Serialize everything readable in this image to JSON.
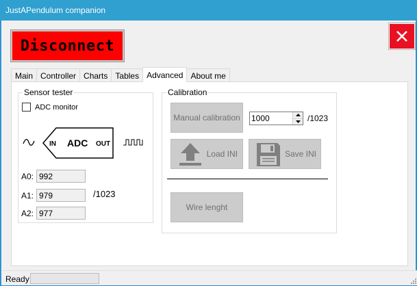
{
  "window": {
    "title": "JustAPendulum companion"
  },
  "header": {
    "disconnect_label": "Disconnect",
    "close_icon": "close-icon"
  },
  "tabs": [
    {
      "label": "Main"
    },
    {
      "label": "Controller"
    },
    {
      "label": "Charts"
    },
    {
      "label": "Tables"
    },
    {
      "label": "Advanced"
    },
    {
      "label": "About me"
    }
  ],
  "sensor_tester": {
    "title": "Sensor tester",
    "adc_monitor_label": "ADC monitor",
    "adc_monitor_checked": false,
    "diagram": {
      "in_label": "IN",
      "adc_label": "ADC",
      "out_label": "OUT"
    },
    "readings": [
      {
        "label": "A0:",
        "value": "992"
      },
      {
        "label": "A1:",
        "value": "979"
      },
      {
        "label": "A2:",
        "value": "977"
      }
    ],
    "max_label": "/1023"
  },
  "calibration": {
    "title": "Calibration",
    "manual_label": "Manual calibration",
    "spin_value": "1000",
    "spin_max_label": "/1023",
    "load_label": "Load INI",
    "save_label": "Save INI",
    "wire_label": "Wire lenght"
  },
  "status": {
    "text": "Ready"
  },
  "colors": {
    "disconnect_bg": "#ff0000",
    "close_bg": "#e81123",
    "titlebar": "#2fa0cf",
    "button_gray": "#cccccc"
  }
}
